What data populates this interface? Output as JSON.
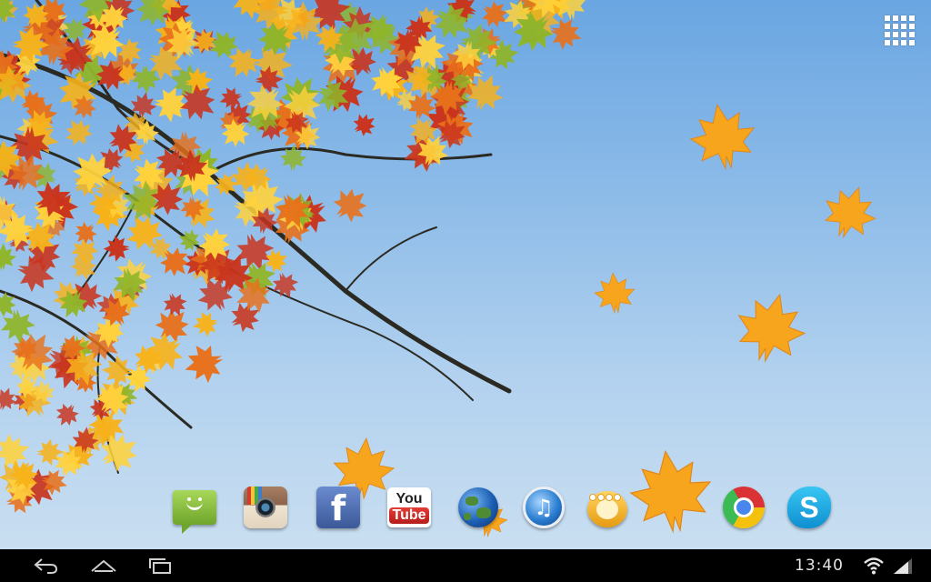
{
  "status_bar": {
    "time": "13:40",
    "wifi_icon": "wifi-icon",
    "signal_icon": "cell-signal-icon"
  },
  "navigation": {
    "back_icon": "back-icon",
    "home_icon": "home-icon",
    "recent_icon": "recent-apps-icon"
  },
  "launcher": {
    "app_drawer_icon": "app-drawer-grid-icon"
  },
  "dock": {
    "apps": [
      {
        "id": "messaging",
        "icon": "messaging-icon"
      },
      {
        "id": "instagram",
        "icon": "instagram-icon"
      },
      {
        "id": "facebook",
        "icon": "facebook-icon",
        "glyph": "f"
      },
      {
        "id": "youtube",
        "icon": "youtube-icon",
        "text_you": "You",
        "text_tube": "Tube"
      },
      {
        "id": "browser",
        "icon": "browser-globe-icon"
      },
      {
        "id": "music",
        "icon": "music-icon",
        "glyph": "♫"
      },
      {
        "id": "video-player",
        "icon": "video-player-icon"
      },
      {
        "id": "chrome",
        "icon": "chrome-icon"
      },
      {
        "id": "skype",
        "icon": "skype-icon",
        "glyph": "S"
      }
    ]
  },
  "wallpaper": {
    "subject": "autumn maple tree leaves against blue sky",
    "sky_top": "#6aa6e2",
    "sky_bottom": "#c9def0",
    "leaf_colors": [
      "#f7b21a",
      "#e8701a",
      "#c9341d",
      "#8fb52a",
      "#ffd23c"
    ]
  }
}
